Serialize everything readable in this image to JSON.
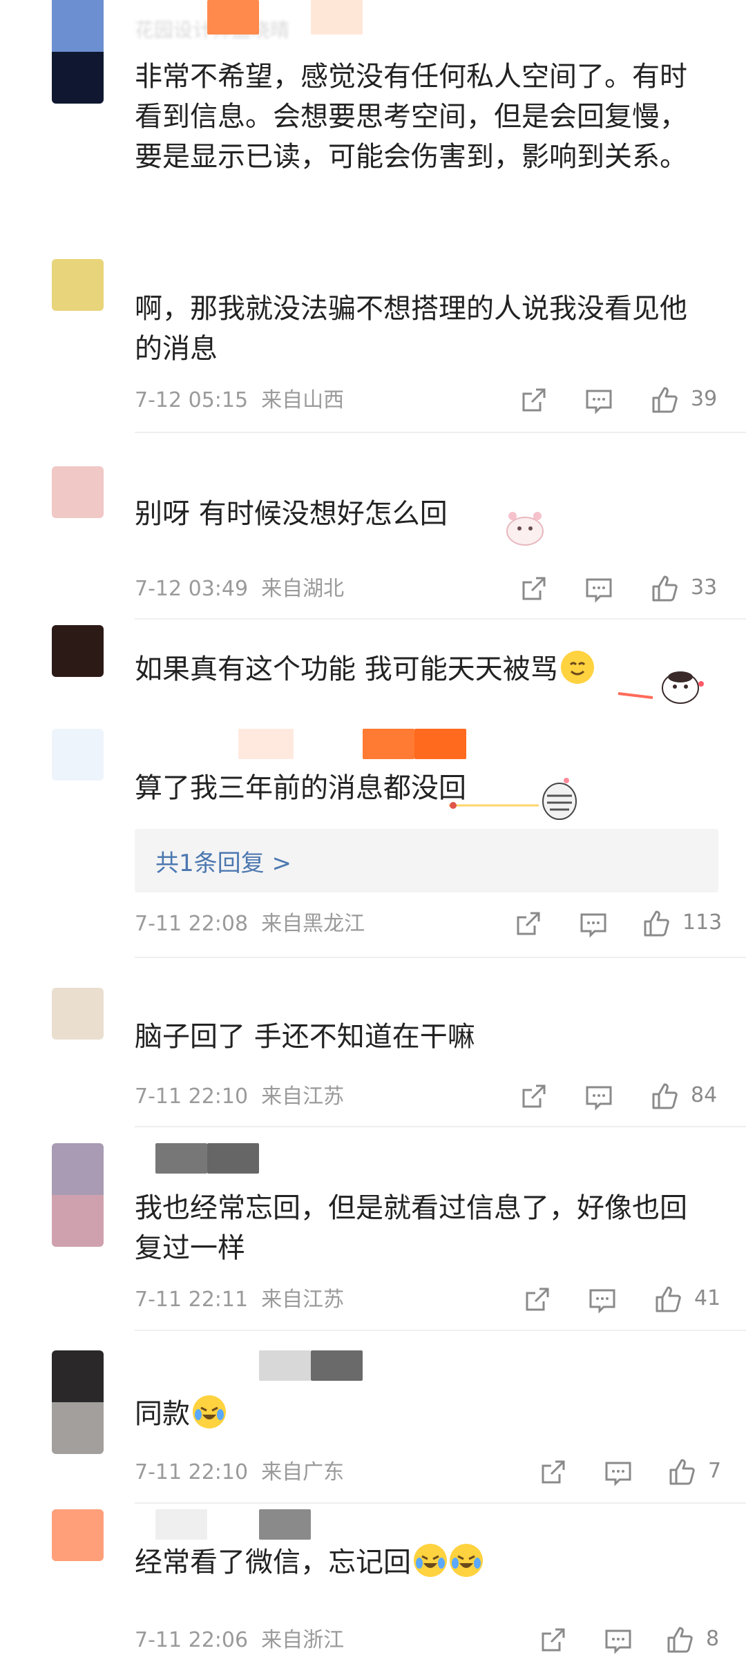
{
  "comments": [
    {
      "id": "c1",
      "avatar": {
        "top": "#6b8fd0",
        "bottom": "#0f1830"
      },
      "username": "花园设计师孟晓晴",
      "text": "非常不希望，感觉没有任何私人空间了。有时看到信息。会想要思考空间，但是会回复慢，要是显示已读，可能会伤害到，影响到关系。"
    },
    {
      "id": "c2",
      "avatar": {
        "top": "#e8d47a",
        "bottom": "#ffffff"
      },
      "username": "",
      "text": "啊，那我就没法骗不想搭理的人说我没看见他的消息",
      "date": "7-12 05:15",
      "location": "来自山西",
      "likes": "39"
    },
    {
      "id": "c3",
      "avatar": {
        "top": "#f0c8c6",
        "bottom": "#ffffff"
      },
      "username": "",
      "text": "别呀 有时候没想好怎么回",
      "date": "7-12 03:49",
      "location": "来自湖北",
      "likes": "33"
    },
    {
      "id": "c4",
      "avatar": {
        "top": "#2b1a16",
        "bottom": "#ffffff"
      },
      "username": "",
      "text": "如果真有这个功能 我可能天天被骂"
    },
    {
      "id": "c5",
      "avatar": {
        "top": "#eef4fb",
        "bottom": "#ffffff"
      },
      "username": "",
      "text": "算了我三年前的消息都没回",
      "reply_link": "共1条回复 >",
      "date": "7-11 22:08",
      "location": "来自黑龙江",
      "likes": "113"
    },
    {
      "id": "c6",
      "avatar": {
        "top": "#eadfcf",
        "bottom": "#ffffff"
      },
      "username": "",
      "text": "脑子回了 手还不知道在干嘛",
      "date": "7-11 22:10",
      "location": "来自江苏",
      "likes": "84"
    },
    {
      "id": "c7",
      "avatar": {
        "top": "#a99bb3",
        "bottom": "#cfa1ae"
      },
      "username": "",
      "text": "我也经常忘回，但是就看过信息了，好像也回复过一样",
      "date": "7-11 22:11",
      "location": "来自江苏",
      "likes": "41"
    },
    {
      "id": "c8",
      "avatar": {
        "top": "#2a2828",
        "bottom": "#a29f9c"
      },
      "username": "",
      "text": "同款",
      "date": "7-11 22:10",
      "location": "来自广东",
      "likes": "7"
    },
    {
      "id": "c9",
      "avatar": {
        "top": "#ff9f7a",
        "bottom": "#ffffff"
      },
      "username": "",
      "text": "经常看了微信，忘记回",
      "date": "7-11 22:06",
      "location": "来自浙江",
      "likes": "8"
    }
  ],
  "icons": {
    "share": "share-icon",
    "comment": "comment-icon",
    "like": "thumbs-up-icon",
    "emoji": "laugh-cry-emoji"
  },
  "colors": {
    "text": "#222222",
    "meta": "#9a9a9a",
    "link": "#4c78b0",
    "divider": "#efefef"
  }
}
